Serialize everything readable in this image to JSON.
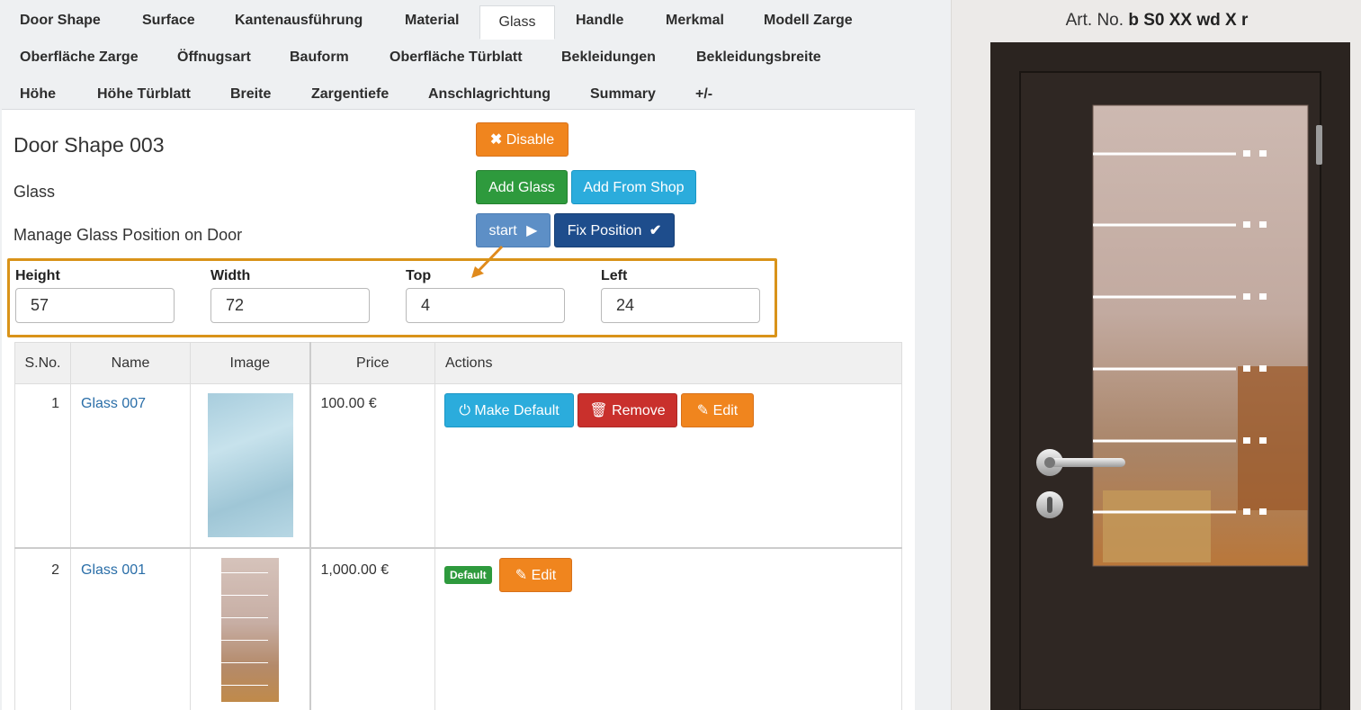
{
  "tabs": {
    "row1": [
      "Door Shape",
      "Surface",
      "Kantenausführung",
      "Material",
      "Glass",
      "Handle",
      "Merkmal",
      "Modell Zarge"
    ],
    "row2": [
      "Oberfläche Zarge",
      "Öffnugsart",
      "Bauform",
      "Oberfläche Türblatt",
      "Bekleidungen",
      "Bekleidungsbreite"
    ],
    "row3": [
      "Höhe",
      "Höhe Türblatt",
      "Breite",
      "Zargentiefe",
      "Anschlagrichtung",
      "Summary",
      "+/-"
    ],
    "active": "Glass"
  },
  "header": {
    "title": "Door Shape 003",
    "section": "Glass",
    "subsection": "Manage Glass Position on Door"
  },
  "buttons": {
    "disable": "Disable",
    "add_glass": "Add Glass",
    "add_from_shop": "Add From Shop",
    "start": "start",
    "fix_position": "Fix Position"
  },
  "position": {
    "height_label": "Height",
    "height_value": "57",
    "width_label": "Width",
    "width_value": "72",
    "top_label": "Top",
    "top_value": "4",
    "left_label": "Left",
    "left_value": "24"
  },
  "table": {
    "headers": [
      "S.No.",
      "Name",
      "Image",
      "Price",
      "Actions"
    ],
    "rows": [
      {
        "sno": "1",
        "name": "Glass 007",
        "price": "100.00 €",
        "actions": [
          "Make Default",
          "Remove",
          "Edit"
        ]
      },
      {
        "sno": "2",
        "name": "Glass 001",
        "price": "1,000.00 €",
        "badge": "Default",
        "actions": [
          "Edit"
        ]
      }
    ]
  },
  "preview": {
    "art_prefix": "Art. No.",
    "art_code": "b S0 XX wd X r"
  },
  "colors": {
    "accent_orange": "#f0851e",
    "highlight_border": "#d99319",
    "door_frame": "#2b2420"
  }
}
